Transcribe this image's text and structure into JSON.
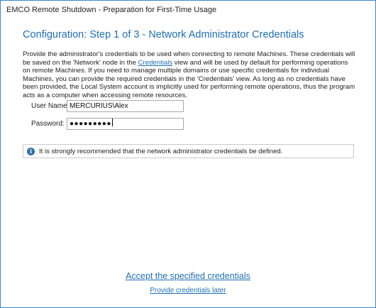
{
  "window": {
    "title": "EMCO Remote Shutdown - Preparation for First-Time Usage"
  },
  "main": {
    "heading": "Configuration: Step 1 of 3 - Network Administrator Credentials",
    "description_before": "Provide the administrator's credentials to be used when connecting to remote Machines. These credentials will be saved on the 'Network' node in the ",
    "description_link": "Credentials",
    "description_after": " view and will be used by default for performing operations on remote Machines. If you need to manage multiple domains or use specific credentials for individual Machines, you can provide the required credentials in the 'Credentials' view. As long as no credentials have been provided, the Local System account is implicitly used for performing remote operations, thus the program acts as a computer when accessing remote resources.",
    "username": {
      "label": "User Name:",
      "value": "MERCURIUS\\Alex"
    },
    "password": {
      "label": "Password:",
      "masked_value": "●●●●●●●●●"
    },
    "info": {
      "icon": "info-icon",
      "text": "It is strongly recommended that the network administrator credentials be defined."
    }
  },
  "actions": {
    "accept_label": "Accept the specified credentials",
    "later_label": "Provide credentials later"
  },
  "colors": {
    "accent": "#1e6fb5",
    "window_border": "#3f86c9",
    "info_icon": "#2b6fb1"
  }
}
